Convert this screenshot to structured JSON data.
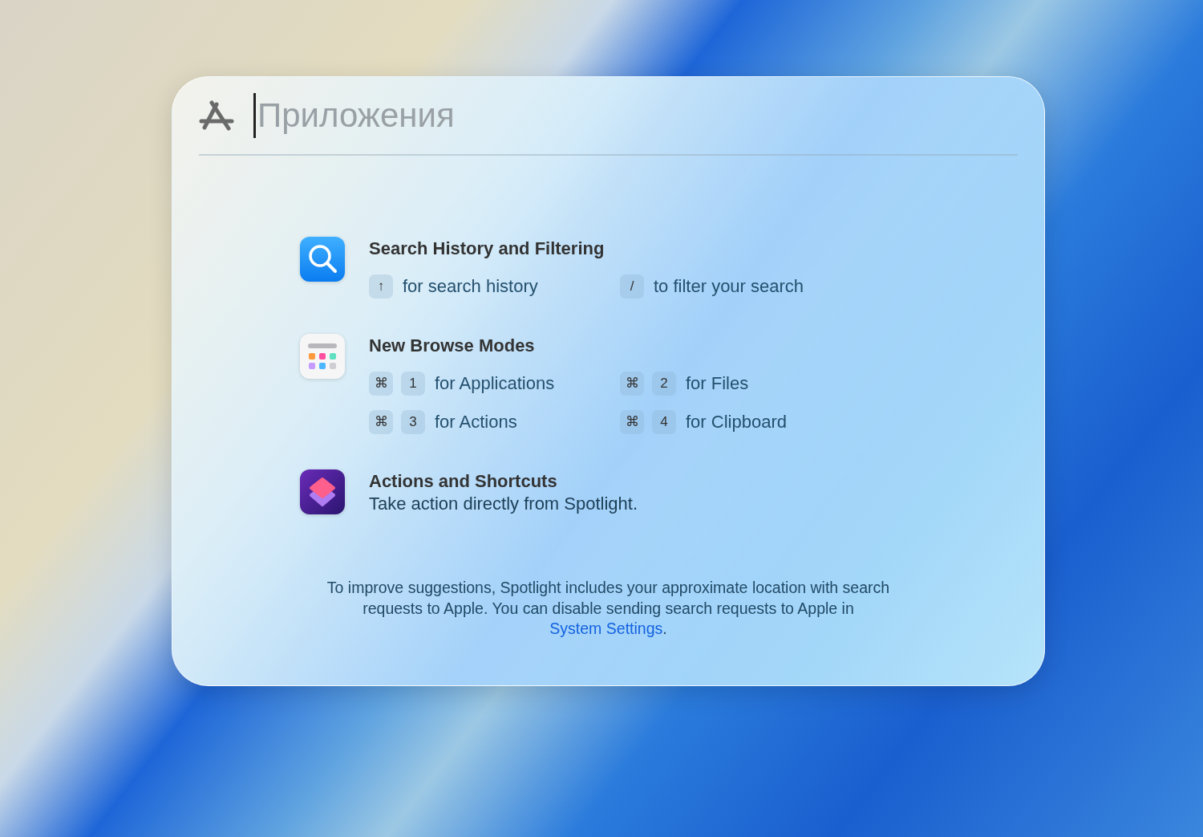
{
  "search": {
    "placeholder": "Приложения"
  },
  "sections": [
    {
      "kind": "shortcuts",
      "title": "Search History and Filtering",
      "shortcuts": [
        {
          "keys": [
            "↑"
          ],
          "label": "for search history"
        },
        {
          "keys": [
            "/"
          ],
          "label": "to filter your search"
        }
      ]
    },
    {
      "kind": "shortcuts",
      "title": "New Browse Modes",
      "shortcuts": [
        {
          "keys": [
            "⌘",
            "1"
          ],
          "label": "for Applications"
        },
        {
          "keys": [
            "⌘",
            "2"
          ],
          "label": "for Files"
        },
        {
          "keys": [
            "⌘",
            "3"
          ],
          "label": "for Actions"
        },
        {
          "keys": [
            "⌘",
            "4"
          ],
          "label": "for Clipboard"
        }
      ]
    },
    {
      "kind": "description",
      "title": "Actions and Shortcuts",
      "description": "Take action directly from Spotlight."
    }
  ],
  "notice": {
    "text": "To improve suggestions, Spotlight includes your approximate location with search requests to Apple. You can disable sending search requests to Apple in",
    "link": "System Settings",
    "after": "."
  }
}
